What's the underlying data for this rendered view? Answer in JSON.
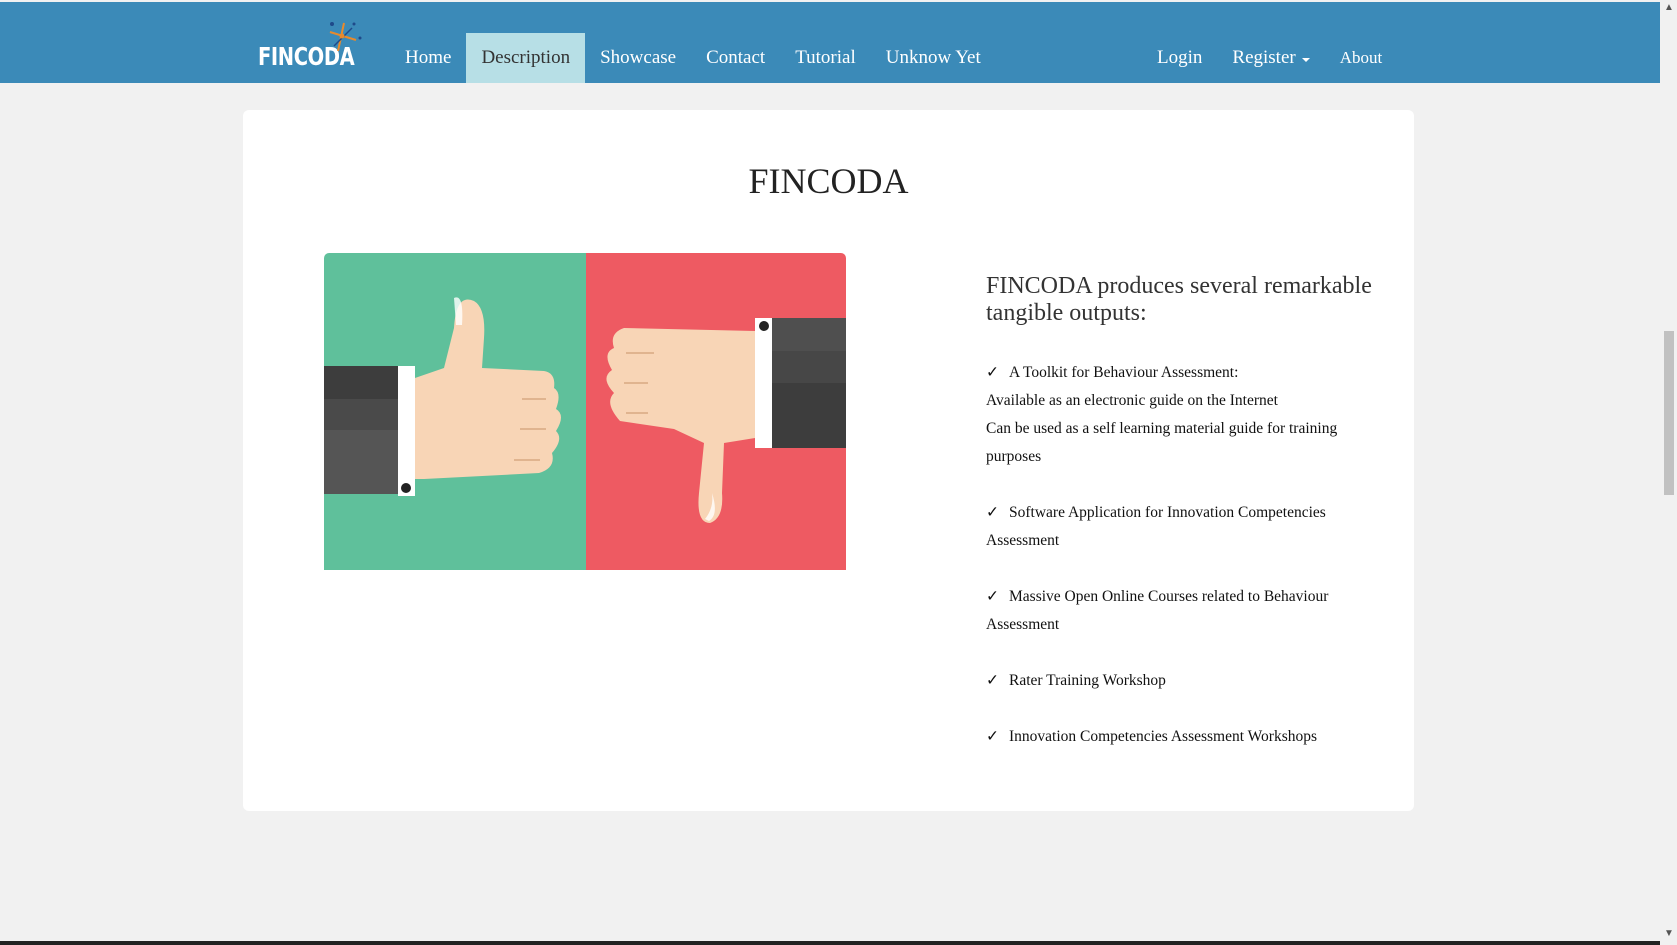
{
  "brand": {
    "name": "FINCODA"
  },
  "nav": {
    "left": [
      {
        "label": "Home"
      },
      {
        "label": "Description",
        "active": true
      },
      {
        "label": "Showcase"
      },
      {
        "label": "Contact"
      },
      {
        "label": "Tutorial"
      },
      {
        "label": "Unknow Yet"
      }
    ],
    "right": {
      "login": "Login",
      "register": "Register",
      "about": "About"
    }
  },
  "main": {
    "title": "FINCODA",
    "illustration": {
      "description_icons": [
        "thumbs-up-icon",
        "thumbs-down-icon"
      ],
      "colors": {
        "left": "#5fc09b",
        "right": "#ee5a62",
        "skin": "#f8d5b6",
        "sleeve": "#444444"
      }
    },
    "subtitle": "FINCODA produces several remarkable tangible outputs:",
    "check_mark": "✓",
    "outputs": [
      [
        "A Toolkit for Behaviour Assessment:",
        "Available as an electronic guide on the Internet",
        "Can be used as a self learning material guide for training purposes"
      ],
      [
        "Software Application for Innovation Competencies Assessment"
      ],
      [
        "Massive Open Online Courses related to Behaviour Assessment"
      ],
      [
        "Rater Training Workshop"
      ],
      [
        "Innovation Competencies Assessment Workshops"
      ]
    ]
  },
  "colors": {
    "navbar": "#3b8ab8",
    "active_tab": "#b7dfe6",
    "page_bg": "#f1f1f1"
  }
}
